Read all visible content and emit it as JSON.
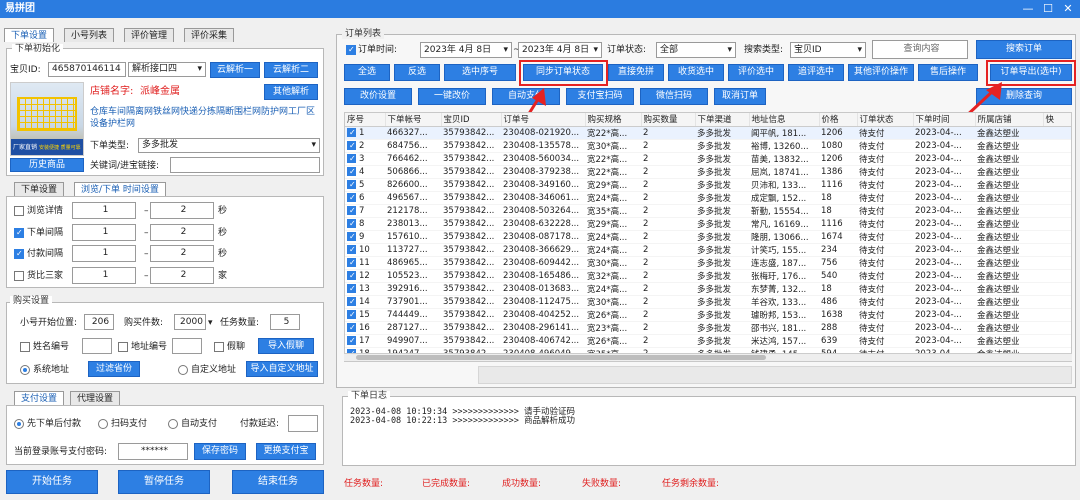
{
  "app": {
    "title": "易拼团"
  },
  "left": {
    "tabs": [
      "下单设置",
      "小号列表",
      "评价管理",
      "评价采集"
    ],
    "init_group": "下单初始化",
    "baby_id_label": "宝贝ID:",
    "baby_id_value": "465870146114",
    "parse_interface": "解析接口四",
    "cloud_parse_1": "云解析一",
    "cloud_parse_2": "云解析二",
    "shop_name_label": "店铺名字:",
    "shop_name_value": "派峰金属",
    "other_parse": "其他解析",
    "product_title": "仓库车间隔离网铁丝网快递分拣隔断围栏网防护网工厂区设备护栏网",
    "order_type_label": "下单类型:",
    "order_type_value": "多多批发",
    "history_goods": "历史商品",
    "keyword_label": "关键词/进宝链接:",
    "image_text_1": "厂家直销",
    "image_text_2": "安装便捷 质量可靠",
    "sub_tabs": [
      "下单设置",
      "浏览/下单 时间设置"
    ],
    "intervals": [
      {
        "label": "浏览详情",
        "checked": false,
        "min": "1",
        "max": "2",
        "unit": "秒"
      },
      {
        "label": "下单间隔",
        "checked": true,
        "min": "1",
        "max": "2",
        "unit": "秒"
      },
      {
        "label": "付款间隔",
        "checked": true,
        "min": "1",
        "max": "2",
        "unit": "秒"
      },
      {
        "label": "货比三家",
        "checked": false,
        "min": "1",
        "max": "2",
        "unit": "家"
      }
    ],
    "buy_group": "购买设置",
    "start_pos_label": "小号开始位置:",
    "start_pos": "206",
    "buy_count_label": "购买件数:",
    "buy_count": "2000",
    "task_count_label": "任务数量:",
    "task_count": "5",
    "name_number": "姓名编号",
    "addr_number": "地址编号",
    "fake_chat": "假聊",
    "import_fake_chat": "导入假聊",
    "sys_address": "系统地址",
    "filter_province": "过滤省份",
    "custom_address": "自定义地址",
    "import_custom_address": "导入自定义地址",
    "pay_tabs": [
      "支付设置",
      "代理设置"
    ],
    "pay_opts": [
      "先下单后付款",
      "扫码支付",
      "自动支付"
    ],
    "pay_delay_label": "付款延迟:",
    "login_pwd_label": "当前登录账号支付密码:",
    "pwd_value": "******",
    "save_pwd": "保存密码",
    "change_pay": "更换支付宝",
    "start_task": "开始任务",
    "pause_task": "暂停任务",
    "end_task": "结束任务"
  },
  "right": {
    "group_title": "订单列表",
    "order_time_label": "订单时间:",
    "date_from": "2023年 4月 8日",
    "date_to": "2023年 4月 8日",
    "order_status_label": "订单状态:",
    "order_status_value": "全部",
    "search_type_label": "搜索类型:",
    "search_type_value": "宝贝ID",
    "query_placeholder": "查询内容",
    "search_order": "搜索订单",
    "btn_row1": [
      "全选",
      "反选",
      "选中序号",
      "同步订单状态",
      "直接免拼",
      "收货选中",
      "评价选中",
      "追评选中",
      "其他评价操作",
      "售后操作",
      "订单导出(选中)"
    ],
    "btn_row2": [
      "改价设置",
      "一键改价",
      "自动支付",
      "支付宝扫码",
      "微信扫码",
      "取消订单",
      "删除查询"
    ],
    "columns": [
      "序号",
      "下单帐号",
      "宝贝ID",
      "订单号",
      "购买规格",
      "购买数量",
      "下单渠道",
      "地址信息",
      "价格",
      "订单状态",
      "下单时间",
      "所属店铺",
      "快"
    ],
    "rows": [
      [
        "1",
        "466327...",
        "35793842...",
        "230408-021920...",
        "宽22*高...",
        "2",
        "多多批发",
        "闻平帆, 181...",
        "1206",
        "待支付",
        "2023-04-...",
        "金鑫达塑业"
      ],
      [
        "2",
        "684756...",
        "35793842...",
        "230408-135578...",
        "宽30*高...",
        "2",
        "多多批发",
        "裕博, 13260...",
        "1080",
        "待支付",
        "2023-04-...",
        "金鑫达塑业"
      ],
      [
        "3",
        "766462...",
        "35793842...",
        "230408-560034...",
        "宽22*高...",
        "2",
        "多多批发",
        "苗美, 13832...",
        "1206",
        "待支付",
        "2023-04-...",
        "金鑫达塑业"
      ],
      [
        "4",
        "506866...",
        "35793842...",
        "230408-379238...",
        "宽22*高...",
        "2",
        "多多批发",
        "屈岚, 18741...",
        "1386",
        "待支付",
        "2023-04-...",
        "金鑫达塑业"
      ],
      [
        "5",
        "826600...",
        "35793842...",
        "230408-349160...",
        "宽29*高...",
        "2",
        "多多批发",
        "贝沛和, 133...",
        "1116",
        "待支付",
        "2023-04-...",
        "金鑫达塑业"
      ],
      [
        "6",
        "496567...",
        "35793842...",
        "230408-346061...",
        "宽24*高...",
        "2",
        "多多批发",
        "成定飘, 152...",
        "18",
        "待支付",
        "2023-04-...",
        "金鑫达塑业"
      ],
      [
        "7",
        "212178...",
        "35793842...",
        "230408-503264...",
        "宽35*高...",
        "2",
        "多多批发",
        "靳勤, 15554...",
        "18",
        "待支付",
        "2023-04-...",
        "金鑫达塑业"
      ],
      [
        "8",
        "238013...",
        "35793842...",
        "230408-632228...",
        "宽29*高...",
        "2",
        "多多批发",
        "常凡, 16169...",
        "1116",
        "待支付",
        "2023-04-...",
        "金鑫达塑业"
      ],
      [
        "9",
        "157610...",
        "35793842...",
        "230408-087178...",
        "宽24*高...",
        "2",
        "多多批发",
        "隆朋, 13066...",
        "1674",
        "待支付",
        "2023-04-...",
        "金鑫达塑业"
      ],
      [
        "10",
        "113727...",
        "35793842...",
        "230408-366629...",
        "宽24*高...",
        "2",
        "多多批发",
        "计笑巧, 155...",
        "234",
        "待支付",
        "2023-04-...",
        "金鑫达塑业"
      ],
      [
        "11",
        "486965...",
        "35793842...",
        "230408-609442...",
        "宽30*高...",
        "2",
        "多多批发",
        "连志盛, 187...",
        "756",
        "待支付",
        "2023-04-...",
        "金鑫达塑业"
      ],
      [
        "12",
        "105523...",
        "35793842...",
        "230408-165486...",
        "宽32*高...",
        "2",
        "多多批发",
        "张梅玗, 176...",
        "540",
        "待支付",
        "2023-04-...",
        "金鑫达塑业"
      ],
      [
        "13",
        "392916...",
        "35793842...",
        "230408-013683...",
        "宽24*高...",
        "2",
        "多多批发",
        "东梦菁, 132...",
        "18",
        "待支付",
        "2023-04-...",
        "金鑫达塑业"
      ],
      [
        "14",
        "737901...",
        "35793842...",
        "230408-112475...",
        "宽30*高...",
        "2",
        "多多批发",
        "羊谷欢, 133...",
        "486",
        "待支付",
        "2023-04-...",
        "金鑫达塑业"
      ],
      [
        "15",
        "744449...",
        "35793842...",
        "230408-404252...",
        "宽26*高...",
        "2",
        "多多批发",
        "璩盼邦, 153...",
        "1638",
        "待支付",
        "2023-04-...",
        "金鑫达塑业"
      ],
      [
        "16",
        "287127...",
        "35793842...",
        "230408-296141...",
        "宽23*高...",
        "2",
        "多多批发",
        "邵书兴, 181...",
        "288",
        "待支付",
        "2023-04-...",
        "金鑫达塑业"
      ],
      [
        "17",
        "949907...",
        "35793842...",
        "230408-406742...",
        "宽26*高...",
        "2",
        "多多批发",
        "米达鸿, 157...",
        "639",
        "待支付",
        "2023-04-...",
        "金鑫达塑业"
      ],
      [
        "18",
        "194247...",
        "35793842...",
        "230408-496049...",
        "宽35*高...",
        "2",
        "多多批发",
        "钱建勇, 145...",
        "594",
        "待支付",
        "2023-04-...",
        "金鑫达塑业"
      ]
    ],
    "log_title": "下单日志",
    "log_lines": [
      "2023-04-08 10:19:34 >>>>>>>>>>>>> 请手动验证码",
      "2023-04-08 10:22:13 >>>>>>>>>>>>> 商品解析成功"
    ],
    "status": [
      "任务数量:",
      "已完成数量:",
      "成功数量:",
      "失败数量:",
      "任务剩余数量:"
    ]
  },
  "colors": {
    "accent": "#2d7fe3",
    "highlight": "#e52222",
    "title_bar": "#2b7ce0"
  }
}
